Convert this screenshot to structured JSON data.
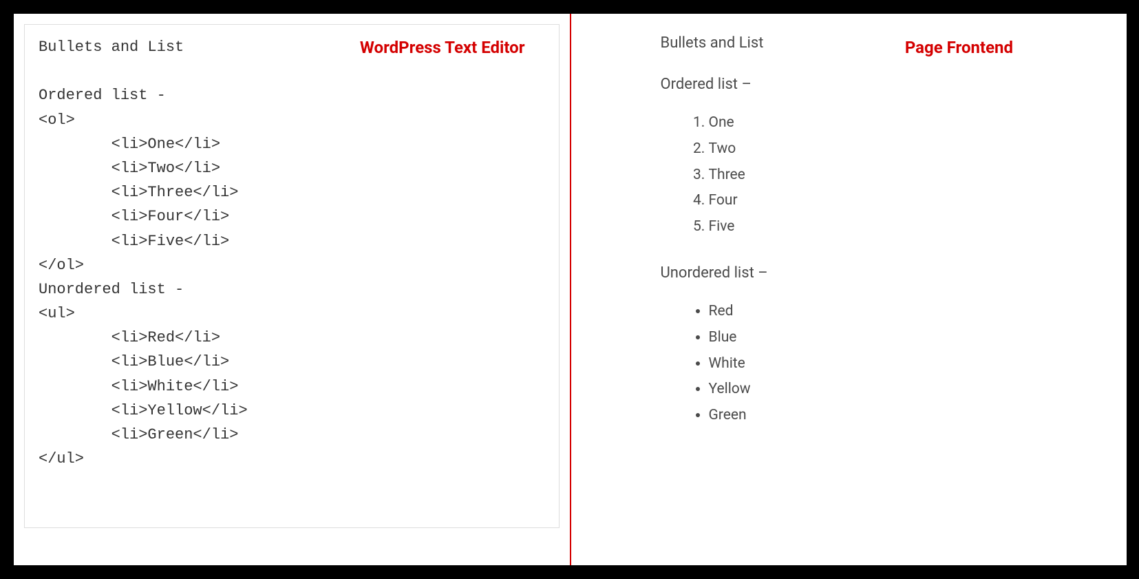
{
  "left": {
    "badge": "WordPress Text Editor",
    "source": "Bullets and List\n\nOrdered list -\n<ol>\n        <li>One</li>\n        <li>Two</li>\n        <li>Three</li>\n        <li>Four</li>\n        <li>Five</li>\n</ol>\nUnordered list -\n<ul>\n        <li>Red</li>\n        <li>Blue</li>\n        <li>White</li>\n        <li>Yellow</li>\n        <li>Green</li>\n</ul>"
  },
  "right": {
    "badge": "Page Frontend",
    "title": "Bullets and List",
    "ordered_label": "Ordered list –",
    "unordered_label": "Unordered list –",
    "ordered_items": [
      "One",
      "Two",
      "Three",
      "Four",
      "Five"
    ],
    "unordered_items": [
      "Red",
      "Blue",
      "White",
      "Yellow",
      "Green"
    ]
  }
}
